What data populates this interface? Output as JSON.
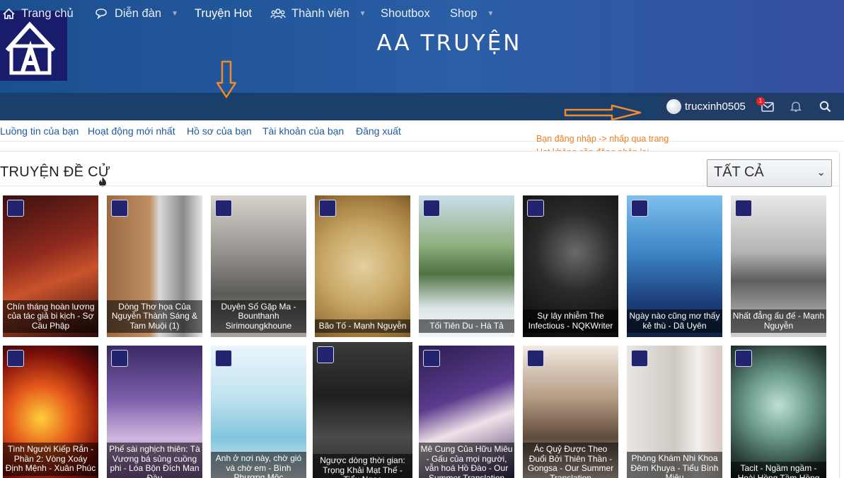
{
  "site": {
    "title": "AA TRUYỆN"
  },
  "nav": {
    "items": [
      {
        "label": "Trang chủ",
        "icon": "home-icon",
        "caret": false
      },
      {
        "label": "Diễn đàn",
        "icon": "comments-icon",
        "caret": true
      },
      {
        "label": "Truyện Hot",
        "icon": "",
        "caret": false
      },
      {
        "label": "Thành viên",
        "icon": "users-icon",
        "caret": true
      },
      {
        "label": "Shoutbox",
        "icon": "",
        "caret": false
      },
      {
        "label": "Shop",
        "icon": "",
        "caret": true
      }
    ],
    "username": "trucxinh0505",
    "inbox_count": "1"
  },
  "subnav": [
    "Luồng tin của bạn",
    "Hoạt động mới nhất",
    "Hồ sơ của bạn",
    "Tài khoản của bạn",
    "Đăng xuất"
  ],
  "annotation": {
    "line1": "Bạn đăng nhập -> nhấp qua trang",
    "line2": "Hot không cần đăng nhập lại",
    "color": "#f27e20"
  },
  "section": {
    "title": "TRUYỆN ĐỀ CỬ",
    "filter": "TẤT CẢ"
  },
  "stories_row1": [
    "Chín tháng hoàn lương của tác giả bi kịch - Sợ Cầu Phập",
    "Dòng Thơ họa Của Nguyễn Thành Sáng & Tam Muội (1)",
    "Duyên Số Gặp Ma - Bounthanh Sirimoungkhoune",
    "Bão Tố - Mạnh Nguyễn",
    "Tối Tiên Du - Hà Tả",
    "Sự lây nhiễm The Infectious - NQKWriter",
    "Ngày nào cũng mơ thấy kẻ thù - Dã Uyên",
    "Nhất đẳng ấu đế - Mạnh Nguyễn"
  ],
  "stories_row2": [
    "Tình Người Kiếp Rắn - Phần 2: Vòng Xoáy Định Mệnh - Xuân Phúc",
    "Phế sài nghịch thiên: Tà Vương bá sủng cuồng phi - Lóa Bộn Đích Man Đầu",
    "Anh ở nơi này, chờ gió và chờ em - Bình Phương Mộc",
    "Ngược dòng thời gian: Trọng Khải Mạt Thế - Tiểu Ngọc",
    "Mê Cung Của Hữu Miêu - Gấu của mọi người, vẫn hoá Hồ Đào - Our Summer Translation",
    "Ác Quỷ Được Theo Đuổi Bởi Thiên Thần - Gongsa - Our Summer Translation",
    "Phòng Khám Nhi Khoa Đêm Khuya - Tiểu Bình Miêu",
    "Tacit - Ngầm ngầm - Hoài Hồng Tầm Hồng"
  ]
}
